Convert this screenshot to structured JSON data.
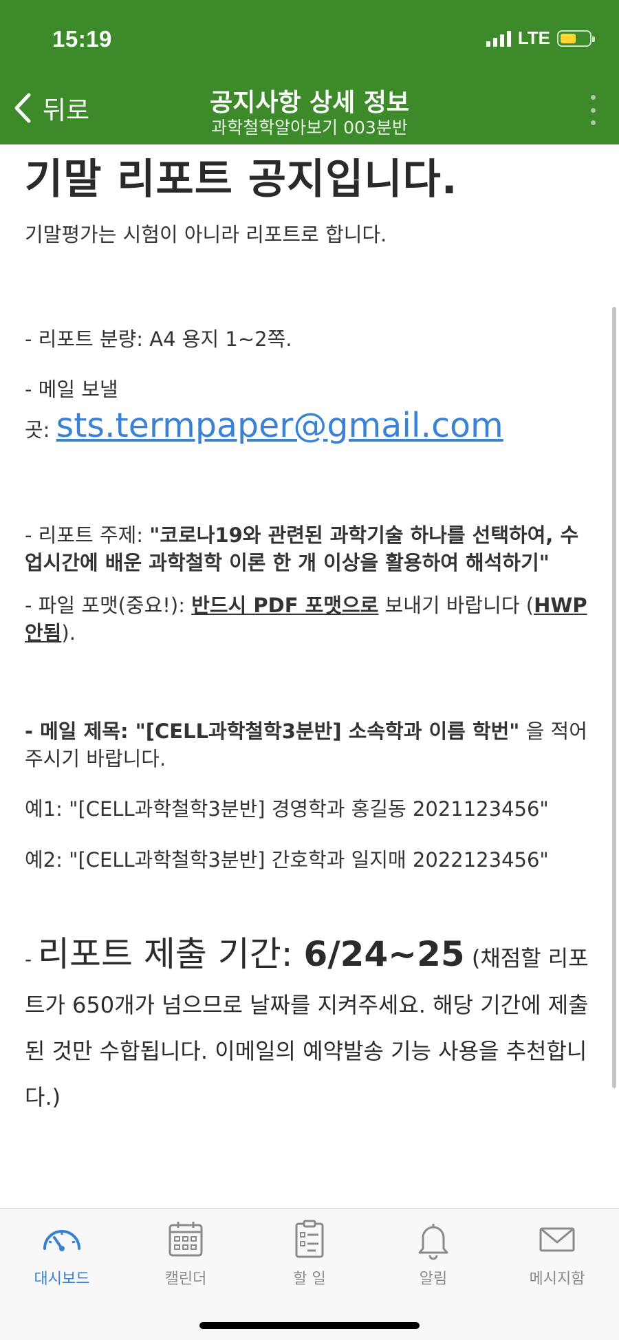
{
  "status_bar": {
    "time": "15:19",
    "network": "LTE"
  },
  "header": {
    "back_label": "뒤로",
    "title": "공지사항 상세 정보",
    "subtitle": "과학철학알아보기 003분반"
  },
  "notice": {
    "heading": "기말 리포트 공지입니다.",
    "intro": "기말평가는 시험이 아니라 리포트로 합니다.",
    "length_line": "- 리포트 분량: A4 용지 1~2쪽.",
    "mail_to_line1": "- 메일 보낼",
    "mail_to_prefix": "곳: ",
    "email": "sts.termpaper@gmail.com",
    "topic_prefix": "- 리포트 주제: ",
    "topic_bold": "\"코로나19와 관련된 과학기술 하나를 선택하여, 수업시간에 배운 과학철학 이론 한 개 이상을 활용하여 해석하기\"",
    "format_prefix": "- 파일 포맷(중요!): ",
    "format_underline": "반드시 PDF 포맷으로",
    "format_mid": " 보내기 바랍니다 (",
    "format_hwp": "HWP 안됨",
    "format_end": ").",
    "subject_bold": "- 메일 제목: \"[CELL과학철학3분반] 소속학과 이름 학번\"",
    "subject_rest": " 을 적어주시기 바랍니다.",
    "example1": "예1: \"[CELL과학철학3분반] 경영학과 홍길동 2021123456\"",
    "example2": "예2: \"[CELL과학철학3분반] 간호학과 일지매 2022123456\"",
    "period_dash": "- ",
    "period_label": "리포트 제출 기간: ",
    "period_dates": "6/24~25",
    "period_note": " (채점할 리포트가 650개가 넘으므로 날짜를 지켜주세요. 해당 기간에 제출된 것만 수합됩니다. 이메일의 예약발송 기능 사용을 추천합니다.)"
  },
  "tabbar": {
    "tabs": [
      {
        "label": "대시보드",
        "icon": "dashboard-gauge-icon",
        "active": true
      },
      {
        "label": "캘린더",
        "icon": "calendar-icon",
        "active": false
      },
      {
        "label": "할 일",
        "icon": "clipboard-checklist-icon",
        "active": false
      },
      {
        "label": "알림",
        "icon": "bell-icon",
        "active": false
      },
      {
        "label": "메시지함",
        "icon": "envelope-icon",
        "active": false
      }
    ]
  },
  "colors": {
    "header_green": "#3d8a2b",
    "link_blue": "#3b82d6",
    "tab_active_blue": "#3b7fd1",
    "tab_inactive_gray": "#8a8a8a",
    "battery_yellow": "#ffd531"
  }
}
